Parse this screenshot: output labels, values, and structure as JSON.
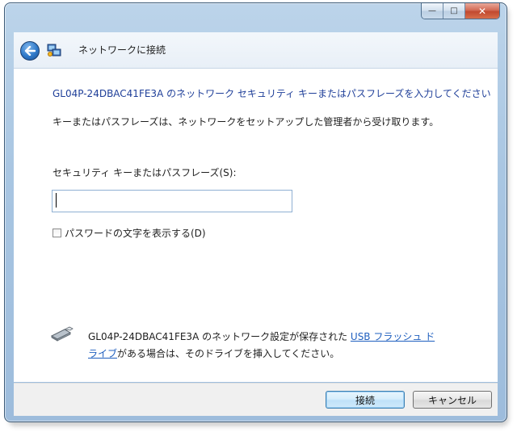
{
  "window": {
    "title": "ネットワークに接続",
    "controls": {
      "minimize": "—",
      "maximize": "□",
      "close": "✕"
    }
  },
  "dialog": {
    "heading": "GL04P-24DBAC41FE3A のネットワーク セキュリティ キーまたはパスフレーズを入力してください",
    "description": "キーまたはパスフレーズは、ネットワークをセットアップした管理者から受け取ります。",
    "key_label": "セキュリティ キーまたはパスフレーズ(S):",
    "key_value": "",
    "show_chars_label": "パスワードの文字を表示する(D)",
    "show_chars_checked": false,
    "usb_text_prefix": "GL04P-24DBAC41FE3A のネットワーク設定が保存された ",
    "usb_link": "USB フラッシュ ドライブ",
    "usb_text_suffix": "がある場合は、そのドライブを挿入してください。"
  },
  "buttons": {
    "connect": "接続",
    "cancel": "キャンセル"
  },
  "icons": {
    "back": "back-arrow-icon",
    "network": "network-icon",
    "usb": "usb-drive-icon"
  },
  "colors": {
    "heading": "#1f3f99",
    "link": "#1f5fbf",
    "frame": "#a9c6e2"
  }
}
